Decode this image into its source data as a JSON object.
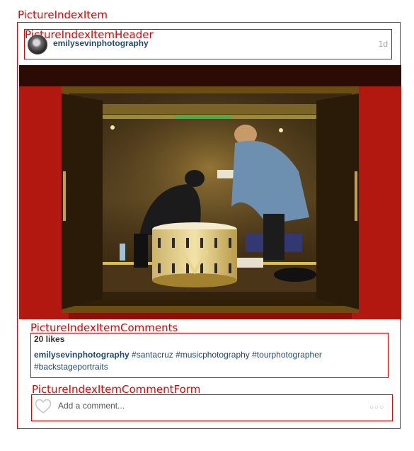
{
  "overlay_labels": {
    "item": "PictureIndexItem",
    "header": "PictureIndexItemHeader",
    "comments": "PictureIndexItemComments",
    "comment_form": "PictureIndexItemCommentForm"
  },
  "header": {
    "username": "emilysevinphotography",
    "time_ago": "1d"
  },
  "comments": {
    "likes": "20 likes",
    "caption_user": "emilysevinphotography",
    "caption_text": " #santacruz #musicphotography #tourphotographer #backstageportraits"
  },
  "comment_form": {
    "placeholder": "Add a comment...",
    "more_icon": "ellipsis-icon",
    "like_icon": "heart-icon"
  },
  "colors": {
    "annotation": "#e30000",
    "link": "#1f4a73"
  }
}
